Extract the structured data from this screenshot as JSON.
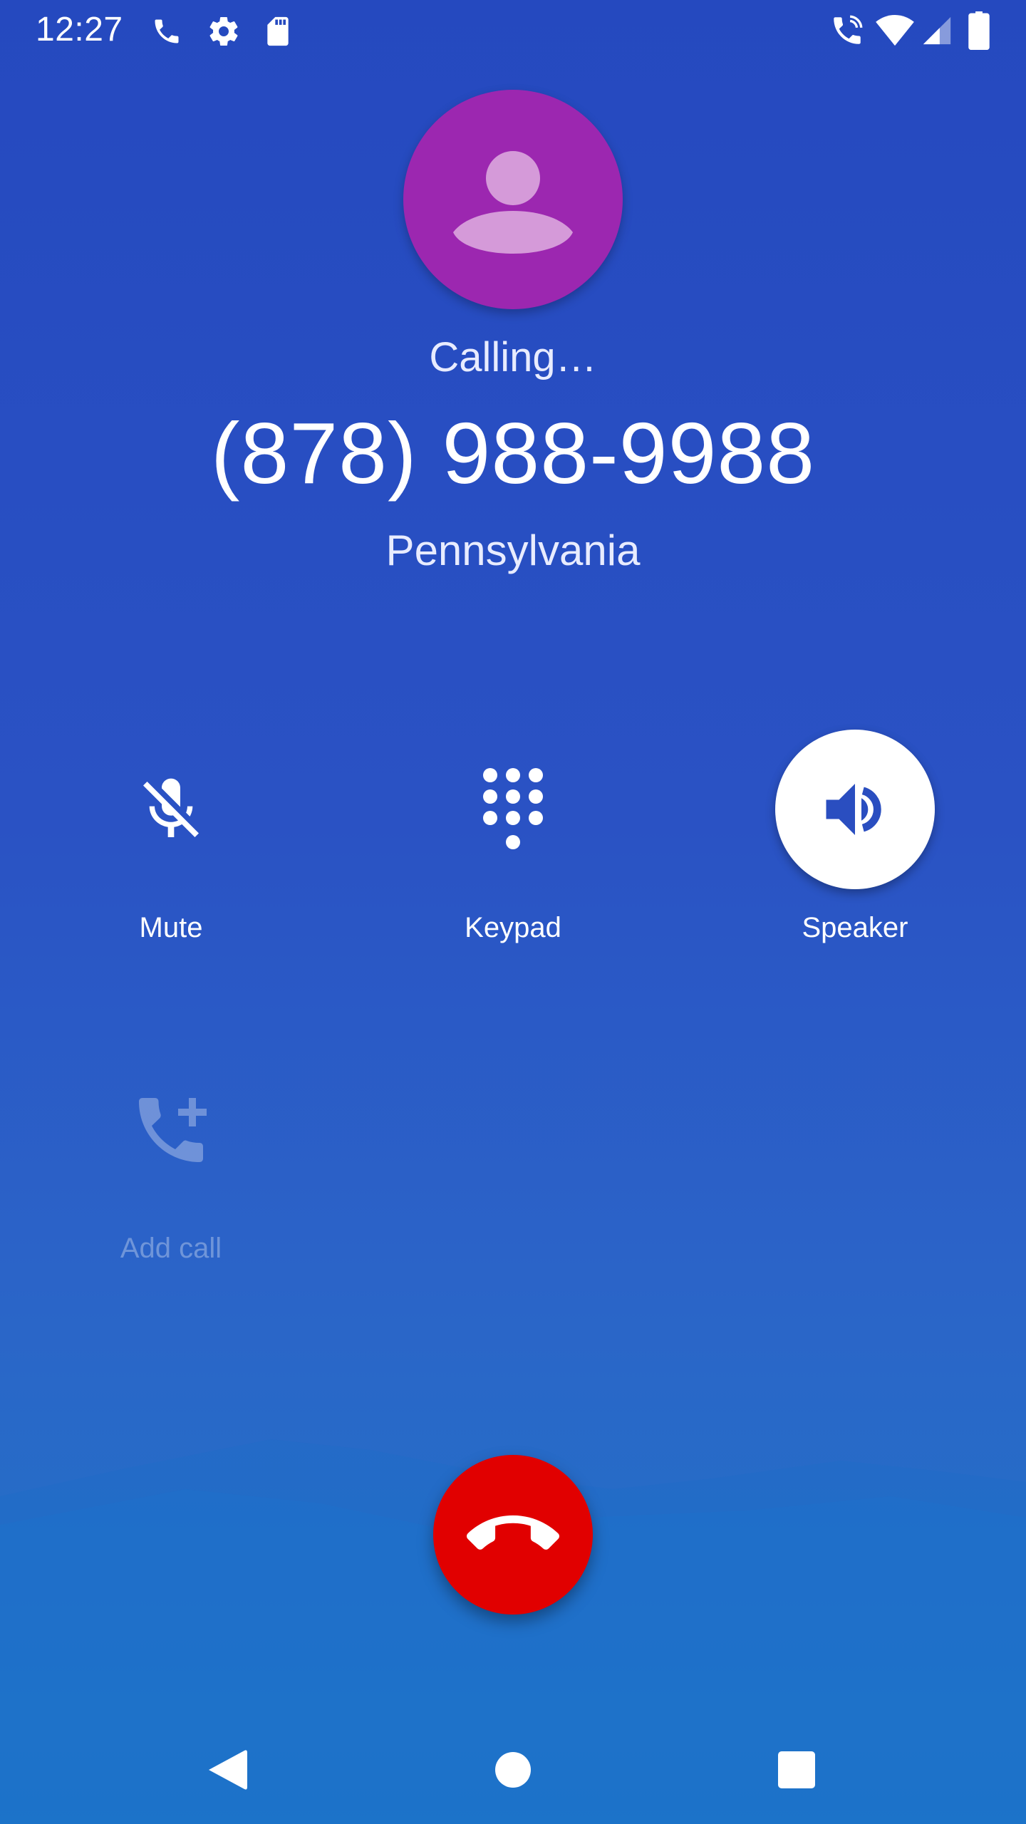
{
  "status_bar": {
    "time": "12:27",
    "left_icons": [
      "phone-icon",
      "gear-icon",
      "sd-card-icon"
    ],
    "right_icons": [
      "wifi-calling-icon",
      "wifi-icon",
      "cell-signal-icon",
      "battery-icon"
    ]
  },
  "call": {
    "status": "Calling…",
    "number": "(878) 988-9988",
    "location": "Pennsylvania"
  },
  "controls": {
    "mute": {
      "label": "Mute",
      "icon": "mic-off-icon",
      "active": false
    },
    "keypad": {
      "label": "Keypad",
      "icon": "dialpad-icon",
      "active": false
    },
    "speaker": {
      "label": "Speaker",
      "icon": "speaker-icon",
      "active": true
    },
    "add_call": {
      "label": "Add call",
      "icon": "add-call-icon",
      "enabled": false
    }
  },
  "end_call": {
    "icon": "end-call-icon",
    "color": "#e10000"
  },
  "nav": {
    "icons": [
      "back-icon",
      "home-icon",
      "recents-icon"
    ]
  },
  "colors": {
    "background_top": "#2549bf",
    "background_bottom": "#2077c6",
    "avatar": "#9c27b0",
    "speaker_icon": "#2a4ec0"
  }
}
